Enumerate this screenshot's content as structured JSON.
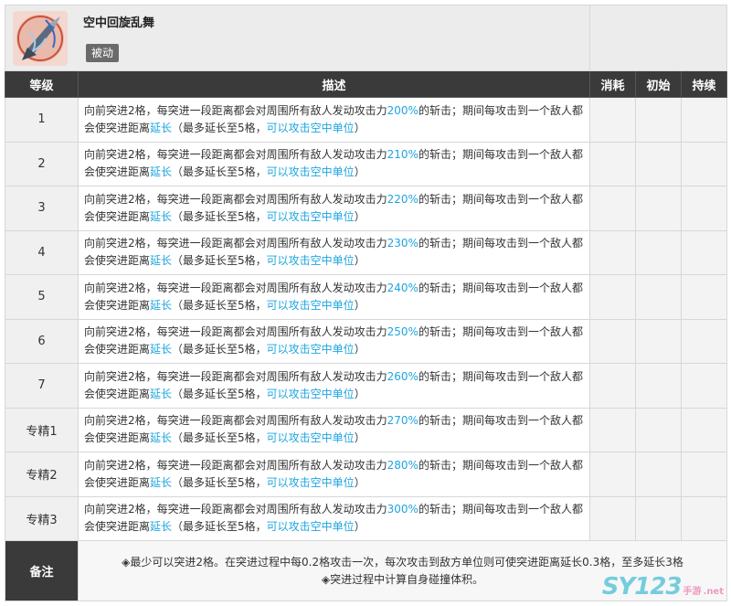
{
  "skill": {
    "name": "空中回旋乱舞",
    "tag": "被动",
    "icon": "blade-whirl-skill-icon"
  },
  "columns": {
    "level": "等级",
    "description": "描述",
    "cost": "消耗",
    "initial": "初始",
    "duration": "持续"
  },
  "description_parts": {
    "a": "向前突进2格，每突进一段距离都会对周围所有敌人发动攻击力",
    "b": "的斩击；期间每攻击到一个敌人都会使突进距离",
    "extend": "延长",
    "c": "（最多延长至5格，",
    "air": "可以攻击空中单位",
    "d": "）"
  },
  "levels": [
    {
      "level": "1",
      "pct": "200%"
    },
    {
      "level": "2",
      "pct": "210%"
    },
    {
      "level": "3",
      "pct": "220%"
    },
    {
      "level": "4",
      "pct": "230%"
    },
    {
      "level": "5",
      "pct": "240%"
    },
    {
      "level": "6",
      "pct": "250%"
    },
    {
      "level": "7",
      "pct": "260%"
    },
    {
      "level": "专精1",
      "pct": "270%"
    },
    {
      "level": "专精2",
      "pct": "280%"
    },
    {
      "level": "专精3",
      "pct": "300%"
    }
  ],
  "notes": {
    "label": "备注",
    "line1": "◈最少可以突进2格。在突进过程中每0.2格攻击一次，每次攻击到敌方单位则可使突进距离延长0.3格，至多延长3格",
    "line2": "◈突进过程中计算自身碰撞体积。"
  },
  "watermark": {
    "brand": "SY123",
    "sub": "手游",
    "domain": ".net"
  },
  "colors": {
    "header_dark": "#3a3a3a",
    "highlight_blue": "#1ea5e0"
  }
}
